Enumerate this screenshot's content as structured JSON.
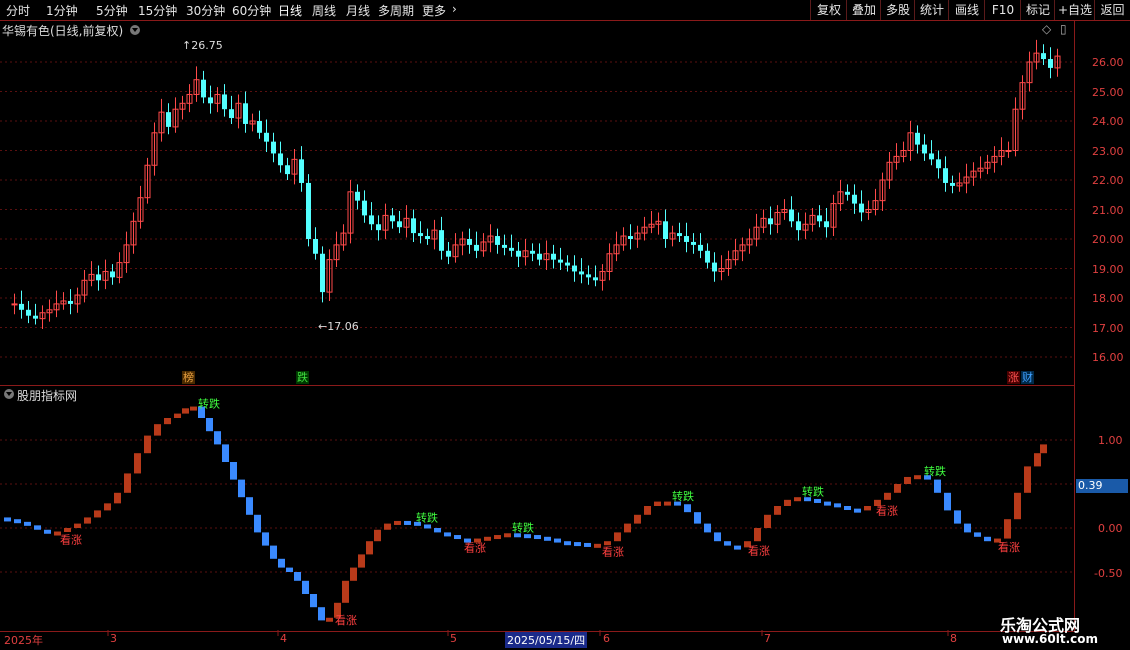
{
  "toolbar": {
    "periods": [
      "分时",
      "1分钟",
      "5分钟",
      "15分钟",
      "30分钟",
      "60分钟",
      "日线",
      "周线",
      "月线",
      "多周期",
      "更多"
    ],
    "active": "日线",
    "right": [
      "复权",
      "叠加",
      "多股",
      "统计",
      "画线",
      "F10",
      "标记",
      "+自选",
      "返回"
    ]
  },
  "main_pane": {
    "title": "华锡有色(日线,前复权)",
    "high_label": "26.75",
    "low_label": "17.06",
    "y_ticks": [
      "26.00",
      "25.00",
      "24.00",
      "23.00",
      "22.00",
      "21.00",
      "20.00",
      "19.00",
      "18.00",
      "17.00",
      "16.00"
    ],
    "events": [
      {
        "text": "榜",
        "color": "#e8a040"
      },
      {
        "text": "跌",
        "color": "#40e040"
      },
      {
        "text": "涨",
        "color": "#ff4040"
      },
      {
        "text": "财",
        "color": "#40a0ff"
      }
    ]
  },
  "indicator_pane": {
    "title": "股朋指标网",
    "current_value": "0.39",
    "y_ticks": [
      "1.00",
      "0.50",
      "0.00",
      "-0.50"
    ],
    "signal_up": "看涨",
    "signal_down": "转跌"
  },
  "x_axis": {
    "labels": [
      "2025年",
      "3",
      "4",
      "5",
      "2025/05/15/四",
      "6",
      "7",
      "8"
    ]
  },
  "watermark": {
    "line1": "乐淘公式网",
    "line2": "www.60lt.com"
  },
  "colors": {
    "up": "#ff4a4a",
    "down": "#54ffff",
    "ind_up": "#b83a1a",
    "ind_down": "#3a8aff",
    "grid": "#5a1010"
  },
  "chart_data": {
    "type": "candlestick",
    "ylim": [
      16.0,
      26.75
    ],
    "high": 26.75,
    "low": 17.06,
    "close_points": [
      [
        0,
        17.8
      ],
      [
        8,
        17.8
      ],
      [
        15,
        17.6
      ],
      [
        22,
        17.4
      ],
      [
        29,
        17.3
      ],
      [
        36,
        17.5
      ],
      [
        43,
        17.6
      ],
      [
        50,
        17.8
      ],
      [
        57,
        17.9
      ],
      [
        64,
        17.8
      ],
      [
        71,
        18.1
      ],
      [
        78,
        18.6
      ],
      [
        85,
        18.8
      ],
      [
        92,
        18.6
      ],
      [
        99,
        18.9
      ],
      [
        106,
        18.7
      ],
      [
        113,
        19.2
      ],
      [
        120,
        19.8
      ],
      [
        127,
        20.6
      ],
      [
        134,
        21.4
      ],
      [
        141,
        22.5
      ],
      [
        148,
        23.6
      ],
      [
        155,
        24.3
      ],
      [
        162,
        23.8
      ],
      [
        169,
        24.4
      ],
      [
        176,
        24.6
      ],
      [
        183,
        24.9
      ],
      [
        190,
        25.4
      ],
      [
        197,
        24.8
      ],
      [
        204,
        24.6
      ],
      [
        211,
        24.9
      ],
      [
        218,
        24.4
      ],
      [
        225,
        24.1
      ],
      [
        232,
        24.6
      ],
      [
        239,
        23.9
      ],
      [
        246,
        24.0
      ],
      [
        253,
        23.6
      ],
      [
        260,
        23.3
      ],
      [
        267,
        22.9
      ],
      [
        274,
        22.5
      ],
      [
        281,
        22.2
      ],
      [
        288,
        22.7
      ],
      [
        295,
        21.9
      ],
      [
        302,
        20.0
      ],
      [
        309,
        19.5
      ],
      [
        316,
        18.2
      ],
      [
        323,
        19.3
      ],
      [
        330,
        19.8
      ],
      [
        337,
        20.2
      ],
      [
        344,
        21.6
      ],
      [
        351,
        21.3
      ],
      [
        358,
        20.8
      ],
      [
        365,
        20.5
      ],
      [
        372,
        20.3
      ],
      [
        379,
        20.8
      ],
      [
        386,
        20.6
      ],
      [
        393,
        20.4
      ],
      [
        400,
        20.7
      ],
      [
        407,
        20.2
      ],
      [
        414,
        20.1
      ],
      [
        421,
        20.0
      ],
      [
        428,
        20.3
      ],
      [
        435,
        19.6
      ],
      [
        442,
        19.4
      ],
      [
        449,
        19.8
      ],
      [
        456,
        20.0
      ],
      [
        463,
        19.8
      ],
      [
        470,
        19.6
      ],
      [
        477,
        19.9
      ],
      [
        484,
        20.1
      ],
      [
        491,
        19.8
      ],
      [
        498,
        19.7
      ],
      [
        505,
        19.6
      ],
      [
        512,
        19.4
      ],
      [
        519,
        19.6
      ],
      [
        526,
        19.5
      ],
      [
        533,
        19.3
      ],
      [
        540,
        19.5
      ],
      [
        547,
        19.3
      ],
      [
        554,
        19.2
      ],
      [
        561,
        19.1
      ],
      [
        568,
        18.9
      ],
      [
        575,
        18.8
      ],
      [
        582,
        18.7
      ],
      [
        589,
        18.6
      ],
      [
        596,
        18.9
      ],
      [
        603,
        19.5
      ],
      [
        610,
        19.8
      ],
      [
        617,
        20.1
      ],
      [
        624,
        20.0
      ],
      [
        631,
        20.2
      ],
      [
        638,
        20.4
      ],
      [
        645,
        20.5
      ],
      [
        652,
        20.6
      ],
      [
        659,
        20.0
      ],
      [
        666,
        20.2
      ],
      [
        673,
        20.1
      ],
      [
        680,
        19.9
      ],
      [
        687,
        19.8
      ],
      [
        694,
        19.6
      ],
      [
        701,
        19.2
      ],
      [
        708,
        18.9
      ],
      [
        715,
        19.0
      ],
      [
        722,
        19.3
      ],
      [
        729,
        19.6
      ],
      [
        736,
        19.8
      ],
      [
        743,
        20.0
      ],
      [
        750,
        20.4
      ],
      [
        757,
        20.7
      ],
      [
        764,
        20.5
      ],
      [
        771,
        20.9
      ],
      [
        778,
        21.0
      ],
      [
        785,
        20.6
      ],
      [
        792,
        20.3
      ],
      [
        799,
        20.5
      ],
      [
        806,
        20.8
      ],
      [
        813,
        20.6
      ],
      [
        820,
        20.4
      ],
      [
        827,
        21.2
      ],
      [
        834,
        21.6
      ],
      [
        841,
        21.5
      ],
      [
        848,
        21.2
      ],
      [
        855,
        20.9
      ],
      [
        862,
        21.0
      ],
      [
        869,
        21.3
      ],
      [
        876,
        22.0
      ],
      [
        883,
        22.6
      ],
      [
        890,
        22.8
      ],
      [
        897,
        23.0
      ],
      [
        904,
        23.6
      ],
      [
        911,
        23.2
      ],
      [
        918,
        22.9
      ],
      [
        925,
        22.7
      ],
      [
        932,
        22.4
      ],
      [
        939,
        21.9
      ],
      [
        946,
        21.8
      ],
      [
        953,
        21.9
      ],
      [
        960,
        22.1
      ],
      [
        967,
        22.3
      ],
      [
        974,
        22.4
      ],
      [
        981,
        22.6
      ],
      [
        988,
        22.8
      ],
      [
        995,
        23.0
      ],
      [
        1002,
        23.0
      ],
      [
        1009,
        24.4
      ],
      [
        1016,
        25.3
      ],
      [
        1023,
        26.0
      ],
      [
        1030,
        26.3
      ],
      [
        1037,
        26.1
      ],
      [
        1044,
        25.8
      ],
      [
        1051,
        26.2
      ]
    ],
    "indicator": {
      "ylim": [
        -0.8,
        1.5
      ],
      "points": [
        [
          0,
          0.12
        ],
        [
          10,
          0.1
        ],
        [
          20,
          0.07
        ],
        [
          30,
          0.03
        ],
        [
          40,
          -0.02
        ],
        [
          50,
          -0.04
        ],
        [
          60,
          -0.04
        ],
        [
          70,
          0.0
        ],
        [
          80,
          0.05
        ],
        [
          90,
          0.12
        ],
        [
          100,
          0.2
        ],
        [
          110,
          0.28
        ],
        [
          120,
          0.4
        ],
        [
          130,
          0.62
        ],
        [
          140,
          0.85
        ],
        [
          150,
          1.05
        ],
        [
          160,
          1.18
        ],
        [
          170,
          1.25
        ],
        [
          180,
          1.3
        ],
        [
          188,
          1.36
        ],
        [
          196,
          1.38
        ],
        [
          204,
          1.25
        ],
        [
          212,
          1.1
        ],
        [
          220,
          0.95
        ],
        [
          228,
          0.75
        ],
        [
          236,
          0.55
        ],
        [
          244,
          0.35
        ],
        [
          252,
          0.15
        ],
        [
          260,
          -0.05
        ],
        [
          268,
          -0.2
        ],
        [
          276,
          -0.35
        ],
        [
          284,
          -0.45
        ],
        [
          292,
          -0.5
        ],
        [
          300,
          -0.6
        ],
        [
          308,
          -0.75
        ],
        [
          316,
          -0.9
        ],
        [
          324,
          -1.05
        ],
        [
          332,
          -1.02
        ],
        [
          340,
          -0.85
        ],
        [
          348,
          -0.6
        ],
        [
          356,
          -0.45
        ],
        [
          364,
          -0.3
        ],
        [
          372,
          -0.15
        ],
        [
          380,
          -0.02
        ],
        [
          390,
          0.05
        ],
        [
          400,
          0.08
        ],
        [
          410,
          0.07
        ],
        [
          420,
          0.04
        ],
        [
          430,
          0.0
        ],
        [
          440,
          -0.05
        ],
        [
          450,
          -0.08
        ],
        [
          460,
          -0.12
        ],
        [
          470,
          -0.15
        ],
        [
          480,
          -0.12
        ],
        [
          490,
          -0.1
        ],
        [
          500,
          -0.08
        ],
        [
          510,
          -0.06
        ],
        [
          520,
          -0.07
        ],
        [
          530,
          -0.08
        ],
        [
          540,
          -0.1
        ],
        [
          550,
          -0.12
        ],
        [
          560,
          -0.15
        ],
        [
          570,
          -0.16
        ],
        [
          580,
          -0.17
        ],
        [
          590,
          -0.18
        ],
        [
          600,
          -0.18
        ],
        [
          610,
          -0.15
        ],
        [
          620,
          -0.05
        ],
        [
          630,
          0.05
        ],
        [
          640,
          0.15
        ],
        [
          650,
          0.25
        ],
        [
          660,
          0.3
        ],
        [
          670,
          0.3
        ],
        [
          680,
          0.27
        ],
        [
          690,
          0.18
        ],
        [
          700,
          0.05
        ],
        [
          710,
          -0.05
        ],
        [
          720,
          -0.15
        ],
        [
          730,
          -0.2
        ],
        [
          740,
          -0.22
        ],
        [
          750,
          -0.15
        ],
        [
          760,
          0.0
        ],
        [
          770,
          0.15
        ],
        [
          780,
          0.25
        ],
        [
          790,
          0.32
        ],
        [
          800,
          0.35
        ],
        [
          810,
          0.33
        ],
        [
          820,
          0.3
        ],
        [
          830,
          0.28
        ],
        [
          840,
          0.25
        ],
        [
          850,
          0.22
        ],
        [
          860,
          0.2
        ],
        [
          870,
          0.25
        ],
        [
          880,
          0.32
        ],
        [
          890,
          0.4
        ],
        [
          900,
          0.5
        ],
        [
          910,
          0.58
        ],
        [
          920,
          0.6
        ],
        [
          930,
          0.55
        ],
        [
          940,
          0.4
        ],
        [
          950,
          0.2
        ],
        [
          960,
          0.05
        ],
        [
          970,
          -0.05
        ],
        [
          980,
          -0.1
        ],
        [
          990,
          -0.15
        ],
        [
          1000,
          -0.12
        ],
        [
          1010,
          0.1
        ],
        [
          1020,
          0.4
        ],
        [
          1030,
          0.7
        ],
        [
          1040,
          0.85
        ],
        [
          1046,
          0.95
        ]
      ],
      "signals": [
        {
          "x": 60,
          "type": "up"
        },
        {
          "x": 198,
          "type": "down"
        },
        {
          "x": 335,
          "type": "up"
        },
        {
          "x": 416,
          "type": "down"
        },
        {
          "x": 464,
          "type": "up"
        },
        {
          "x": 512,
          "type": "down"
        },
        {
          "x": 602,
          "type": "up"
        },
        {
          "x": 672,
          "type": "down"
        },
        {
          "x": 748,
          "type": "up"
        },
        {
          "x": 802,
          "type": "down"
        },
        {
          "x": 876,
          "type": "up"
        },
        {
          "x": 924,
          "type": "down"
        },
        {
          "x": 998,
          "type": "up"
        }
      ]
    }
  }
}
